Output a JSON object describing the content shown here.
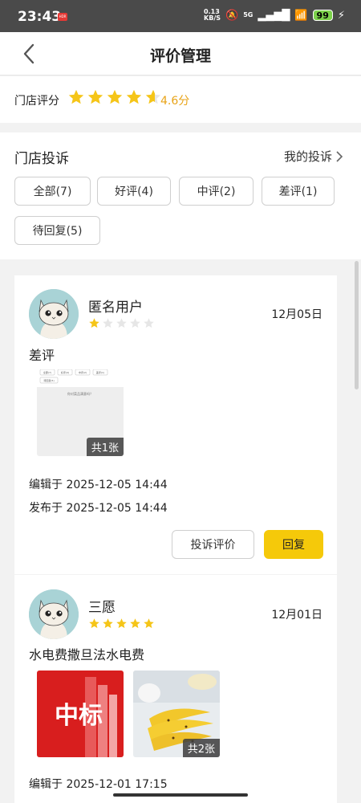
{
  "status": {
    "time": "23:43",
    "net_speed": "0.13",
    "net_unit": "KB/S",
    "network": "5G",
    "battery": "99"
  },
  "header": {
    "title": "评价管理"
  },
  "store_rating": {
    "label": "门店评分",
    "score_text": "4.6分",
    "score": 4.6
  },
  "complaints": {
    "title": "门店投诉",
    "my_complaints": "我的投诉",
    "filters": [
      "全部(7)",
      "好评(4)",
      "中评(2)",
      "差评(1)",
      "待回复(5)"
    ]
  },
  "reviews": [
    {
      "user": "匿名用户",
      "rating": 1,
      "date": "12月05日",
      "text": "差评",
      "image_count": "共1张",
      "edited": "编辑于 2025-12-05 14:44",
      "published": "发布于 2025-12-05 14:44",
      "complain_label": "投诉评价",
      "reply_label": "回复",
      "thumb_chips": [
        "全部(7)",
        "好评(4)",
        "中评(2)",
        "差评(1)",
        "待回复(5)"
      ],
      "thumb_prompt": "你对菜品满意吗？"
    },
    {
      "user": "三愿",
      "rating": 5,
      "date": "12月01日",
      "text": "水电费撒旦法水电费",
      "image_count": "共2张",
      "edited": "编辑于 2025-12-01 17:15",
      "thumb_logo": "中标"
    }
  ],
  "colors": {
    "accent": "#f5c90a",
    "star": "#f5c518",
    "score": "#e8a317"
  }
}
